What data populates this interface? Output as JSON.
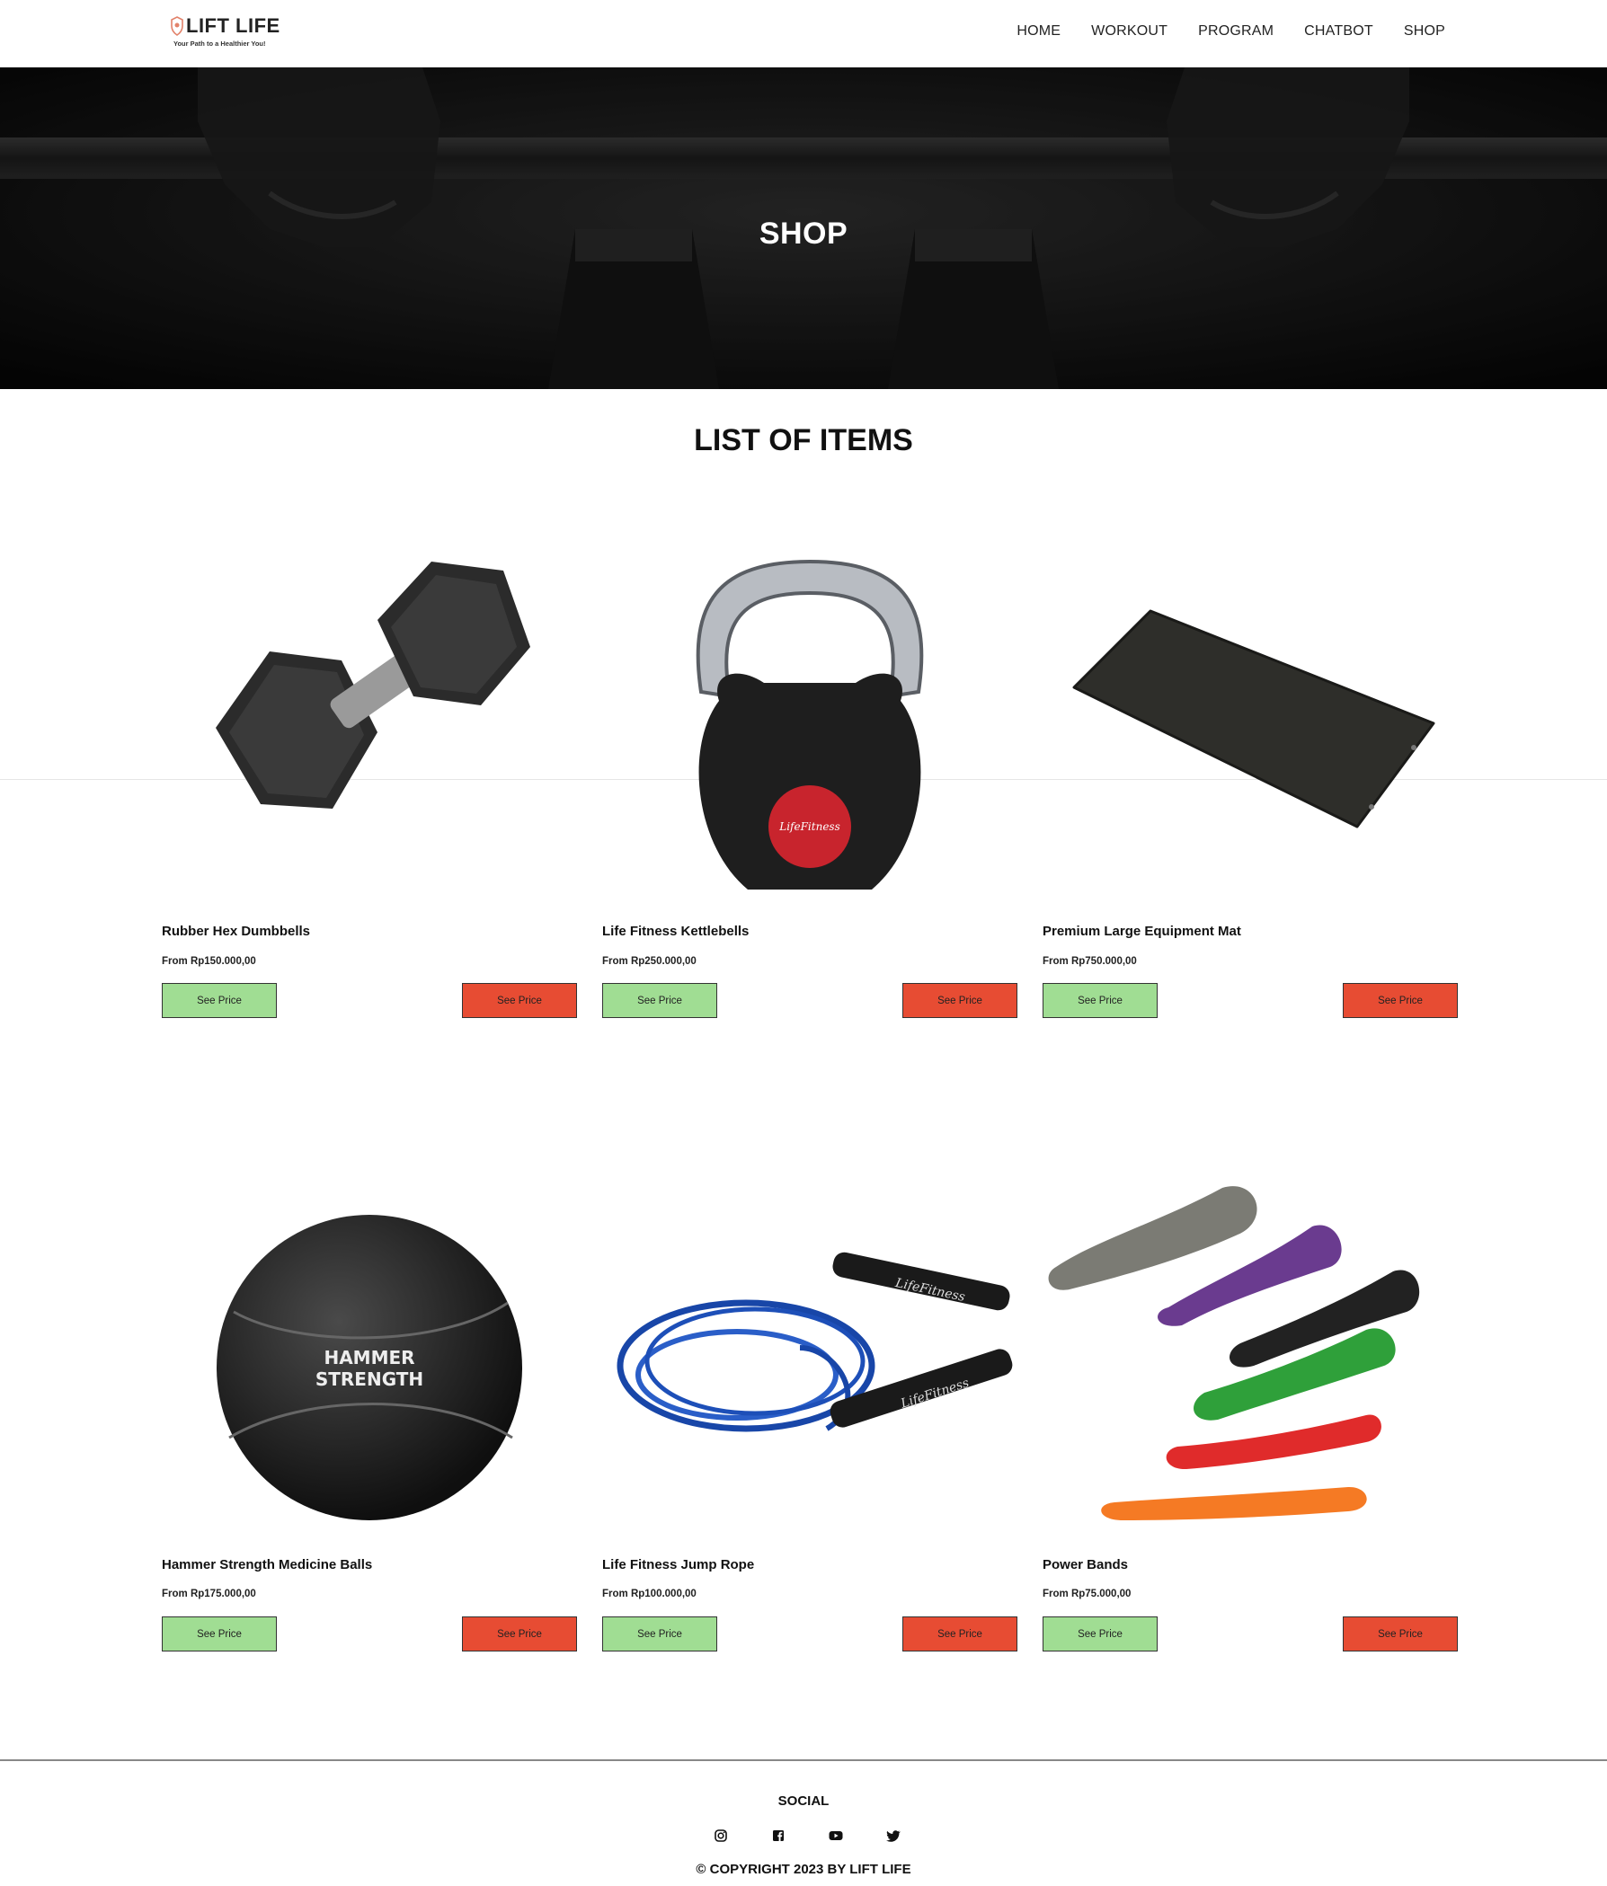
{
  "brand": {
    "name": "LIFT LIFE",
    "tagline": "Your Path to a Healthier You!"
  },
  "nav": {
    "items": [
      {
        "label": "HOME"
      },
      {
        "label": "WORKOUT"
      },
      {
        "label": "PROGRAM"
      },
      {
        "label": "CHATBOT"
      },
      {
        "label": "SHOP"
      }
    ]
  },
  "hero": {
    "title": "SHOP"
  },
  "section": {
    "title": "LIST OF ITEMS"
  },
  "products": [
    {
      "name": "Rubber Hex Dumbbells",
      "price": "From Rp150.000,00",
      "image_icon": "hex-dumbbell-icon",
      "btn_left": "See Price",
      "btn_right": "See Price"
    },
    {
      "name": "Life Fitness Kettlebells",
      "price": "From Rp250.000,00",
      "image_icon": "kettlebell-icon",
      "btn_left": "See Price",
      "btn_right": "See Price"
    },
    {
      "name": "Premium Large Equipment Mat",
      "price": "From Rp750.000,00",
      "image_icon": "exercise-mat-icon",
      "btn_left": "See Price",
      "btn_right": "See Price"
    },
    {
      "name": "Hammer Strength Medicine Balls",
      "price": "From Rp175.000,00",
      "image_icon": "medicine-ball-icon",
      "btn_left": "See Price",
      "btn_right": "See Price"
    },
    {
      "name": "Life Fitness Jump Rope",
      "price": "From Rp100.000,00",
      "image_icon": "jump-rope-icon",
      "btn_left": "See Price",
      "btn_right": "See Price"
    },
    {
      "name": "Power Bands",
      "price": "From Rp75.000,00",
      "image_icon": "resistance-bands-icon",
      "btn_left": "See Price",
      "btn_right": "See Price"
    }
  ],
  "footer": {
    "social_title": "SOCIAL",
    "social_icons": [
      "instagram-icon",
      "facebook-icon",
      "youtube-icon",
      "twitter-icon"
    ],
    "copyright": "© COPYRIGHT 2023 BY LIFT LIFE"
  },
  "colors": {
    "btn_green": "#a0dd93",
    "btn_red": "#e74c33",
    "hero_bg": "#0d0d0d"
  }
}
